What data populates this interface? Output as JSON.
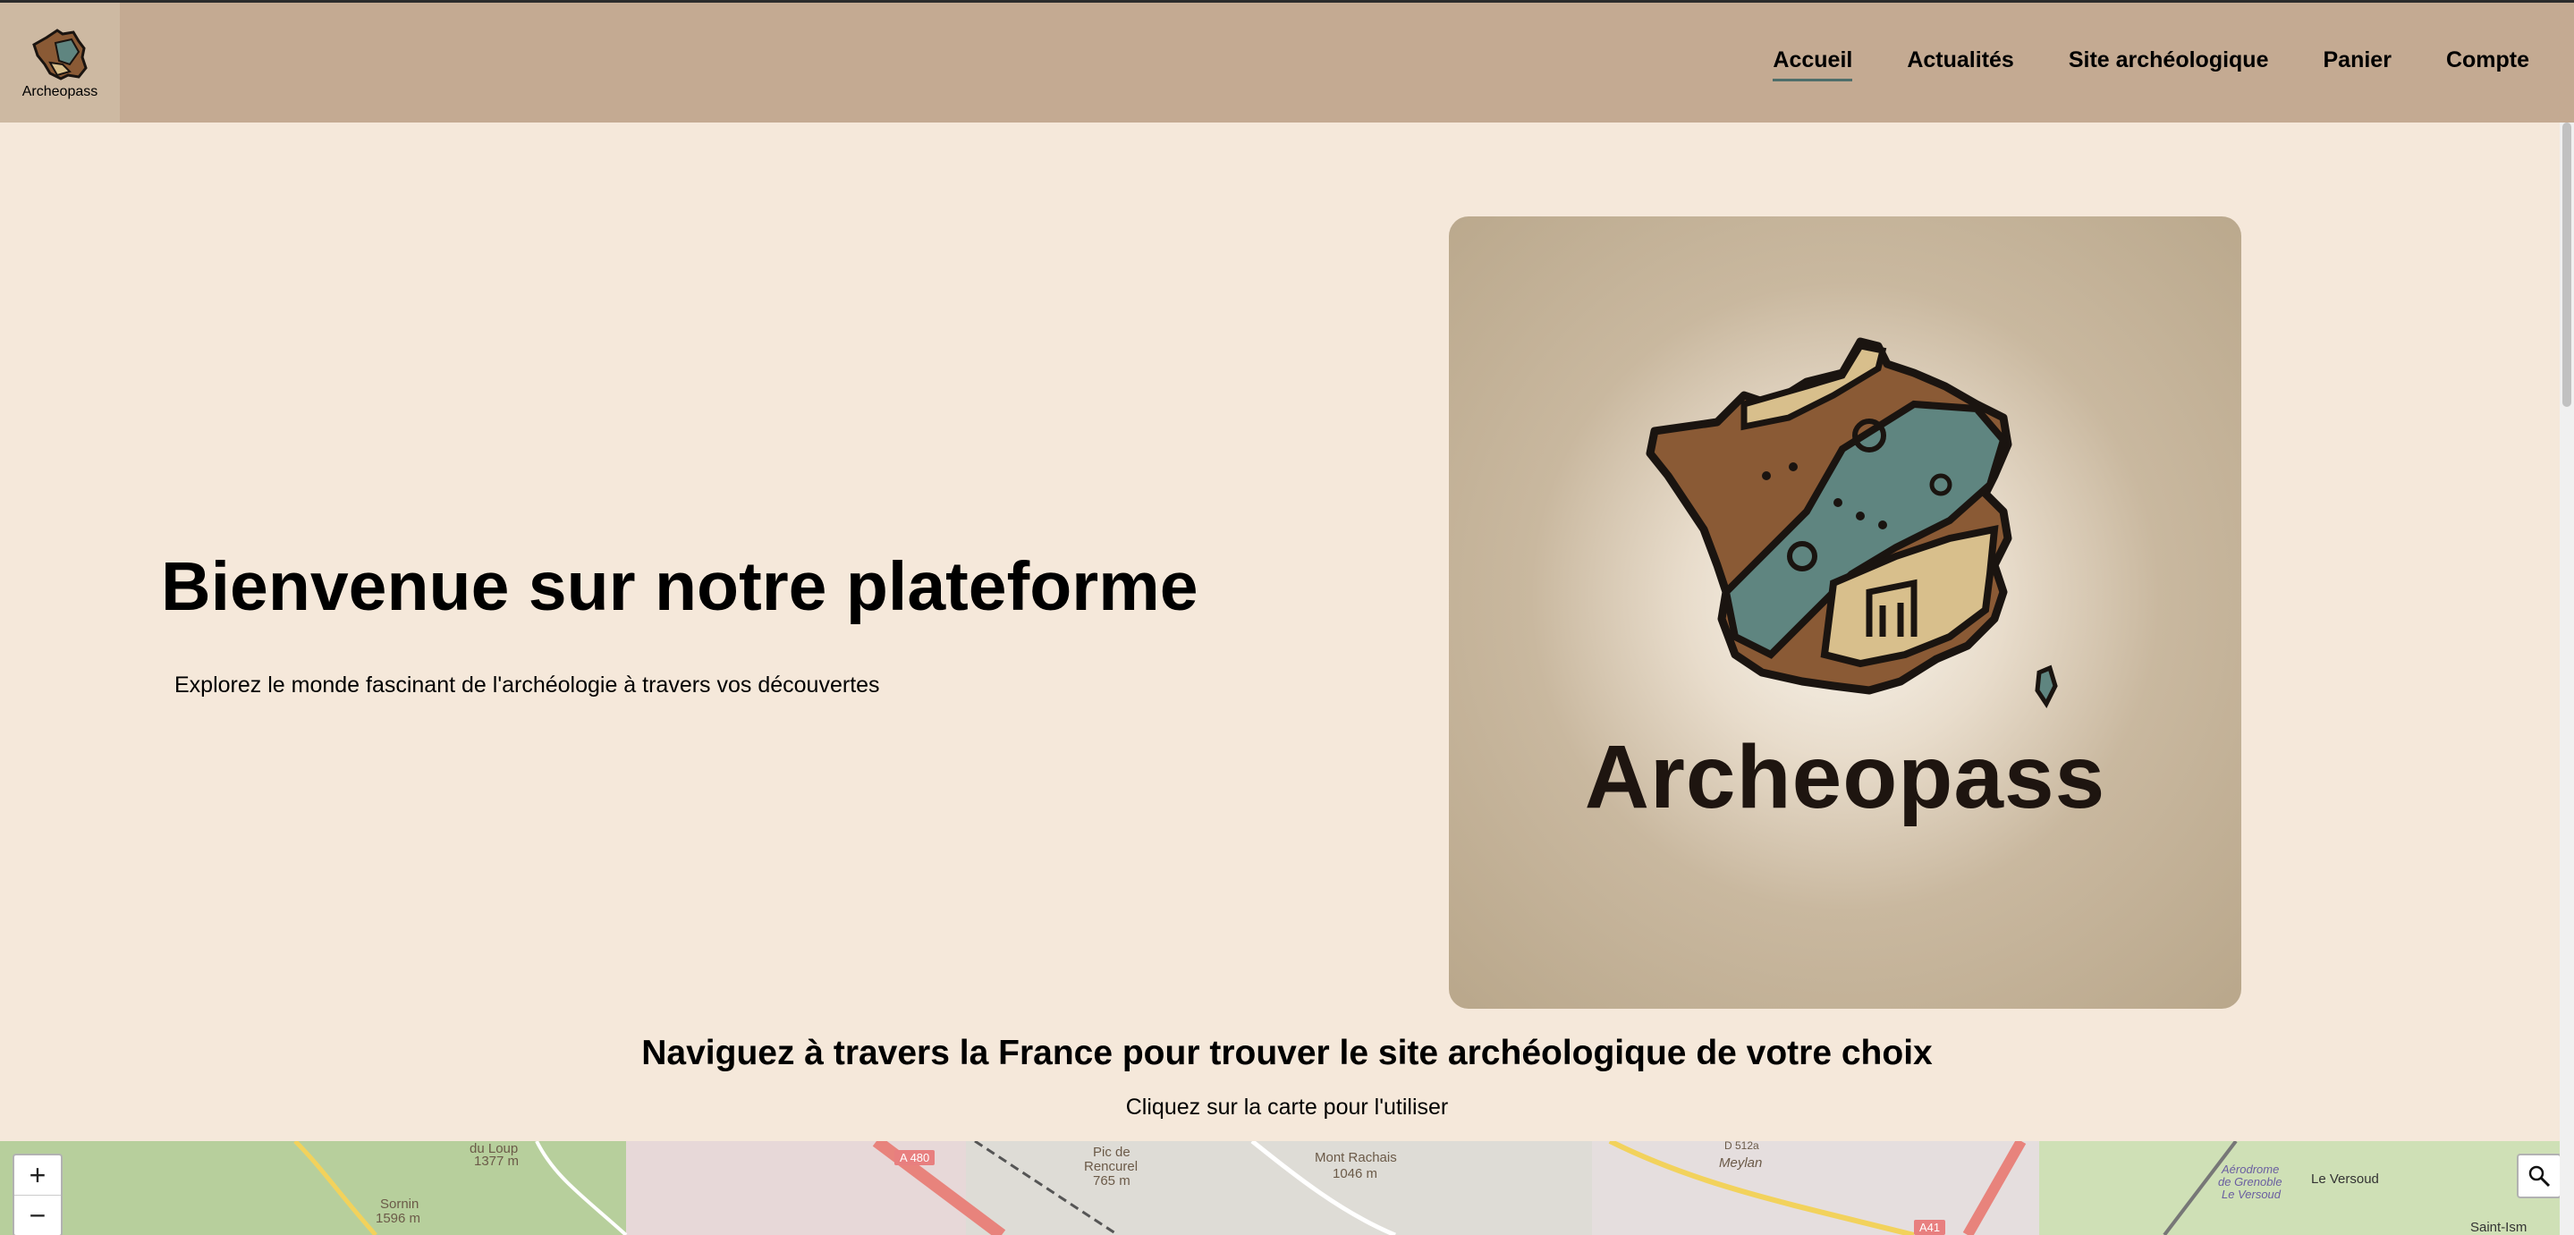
{
  "brand": {
    "logo_text": "Archeopass"
  },
  "nav": {
    "items": [
      {
        "label": "Accueil",
        "active": true
      },
      {
        "label": "Actualités"
      },
      {
        "label": "Site archéologique"
      },
      {
        "label": "Panier"
      },
      {
        "label": "Compte"
      }
    ]
  },
  "hero": {
    "title": "Bienvenue sur notre plateforme",
    "subtitle": "Explorez le monde fascinant de l'archéologie à travers vos découvertes",
    "image_brand_text": "Archeopass"
  },
  "map_section": {
    "title": "Naviguez à travers la France pour trouver le site archéologique de votre choix",
    "subtitle": "Cliquez sur la carte pour l'utiliser"
  },
  "map": {
    "zoom_in": "+",
    "zoom_out": "−",
    "labels": {
      "peak1": "du Loup",
      "peak1_alt": "1377 m",
      "peak2": "Sornin",
      "peak2_alt": "1596 m",
      "road1": "A 480",
      "peak3": "Pic de",
      "peak3b": "Rencurel",
      "peak3_alt": "765 m",
      "peak4": "Mont Rachais",
      "peak4_alt": "1046 m",
      "town1": "Meylan",
      "road2": "D 512a",
      "road3": "A41",
      "airport1": "Aérodrome",
      "airport2": "de Grenoble",
      "airport3": "Le Versoud",
      "town2": "Le Versoud",
      "town3": "Saint-Ism"
    }
  },
  "colors": {
    "header_bg": "#c4aa92",
    "page_bg": "#f5e8da",
    "active_underline": "#4e6e6a"
  }
}
